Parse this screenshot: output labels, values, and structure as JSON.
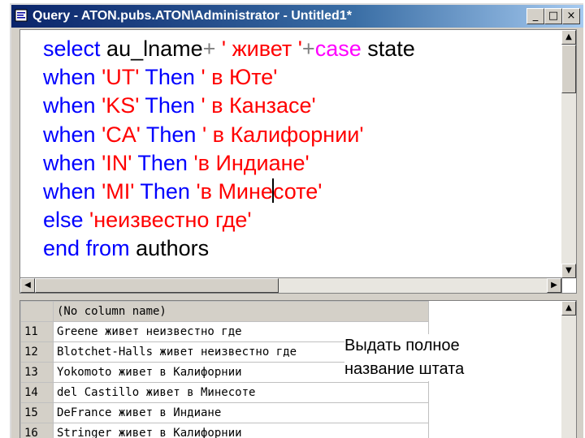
{
  "window": {
    "title": "Query - ATON.pubs.ATON\\Administrator - Untitled1*",
    "buttons": {
      "minimize": "_",
      "maximize": "□",
      "close": "×"
    }
  },
  "editor": {
    "lines": [
      [
        {
          "t": "select ",
          "c": "kw"
        },
        {
          "t": "au_lname",
          "c": "id"
        },
        {
          "t": "+ ",
          "c": "op"
        },
        {
          "t": "' живет '",
          "c": "str"
        },
        {
          "t": "+",
          "c": "op"
        },
        {
          "t": "case ",
          "c": "fn"
        },
        {
          "t": "state",
          "c": "id"
        }
      ],
      [
        {
          "t": "when ",
          "c": "kw"
        },
        {
          "t": "'UT' ",
          "c": "str"
        },
        {
          "t": "Then ",
          "c": "kw"
        },
        {
          "t": "' в Юте'",
          "c": "str"
        }
      ],
      [
        {
          "t": "when ",
          "c": "kw"
        },
        {
          "t": "'KS' ",
          "c": "str"
        },
        {
          "t": "Then ",
          "c": "kw"
        },
        {
          "t": "' в Канзасе'",
          "c": "str"
        }
      ],
      [
        {
          "t": "when ",
          "c": "kw"
        },
        {
          "t": "'CA' ",
          "c": "str"
        },
        {
          "t": "Then ",
          "c": "kw"
        },
        {
          "t": "' в Калифорнии'",
          "c": "str"
        }
      ],
      [
        {
          "t": "when ",
          "c": "kw"
        },
        {
          "t": "'IN' ",
          "c": "str"
        },
        {
          "t": "Then ",
          "c": "kw"
        },
        {
          "t": "'в Индиане'",
          "c": "str"
        }
      ],
      [
        {
          "t": "when ",
          "c": "kw"
        },
        {
          "t": "'MI' ",
          "c": "str"
        },
        {
          "t": "Then ",
          "c": "kw"
        },
        {
          "t": "'в Мине",
          "c": "str"
        },
        {
          "caret": true
        },
        {
          "t": "соте'",
          "c": "str"
        }
      ],
      [
        {
          "t": "else ",
          "c": "kw"
        },
        {
          "t": "'неизвестно где'",
          "c": "str"
        }
      ],
      [
        {
          "t": "end ",
          "c": "kw"
        },
        {
          "t": "from ",
          "c": "kw"
        },
        {
          "t": "authors",
          "c": "id"
        }
      ]
    ]
  },
  "results": {
    "column_header": "(No column name)",
    "rows": [
      {
        "num": "11",
        "value": "Greene живет неизвестно где"
      },
      {
        "num": "12",
        "value": "Blotchet-Halls живет неизвестно где"
      },
      {
        "num": "13",
        "value": "Yokomoto живет  в Калифорнии"
      },
      {
        "num": "14",
        "value": "del Castillo живет в Минесоте"
      },
      {
        "num": "15",
        "value": "DeFrance живет в Индиане"
      },
      {
        "num": "16",
        "value": "Stringer живет  в Калифорнии"
      }
    ]
  },
  "annotation": {
    "line1": "Выдать полное",
    "line2": "название штата"
  }
}
